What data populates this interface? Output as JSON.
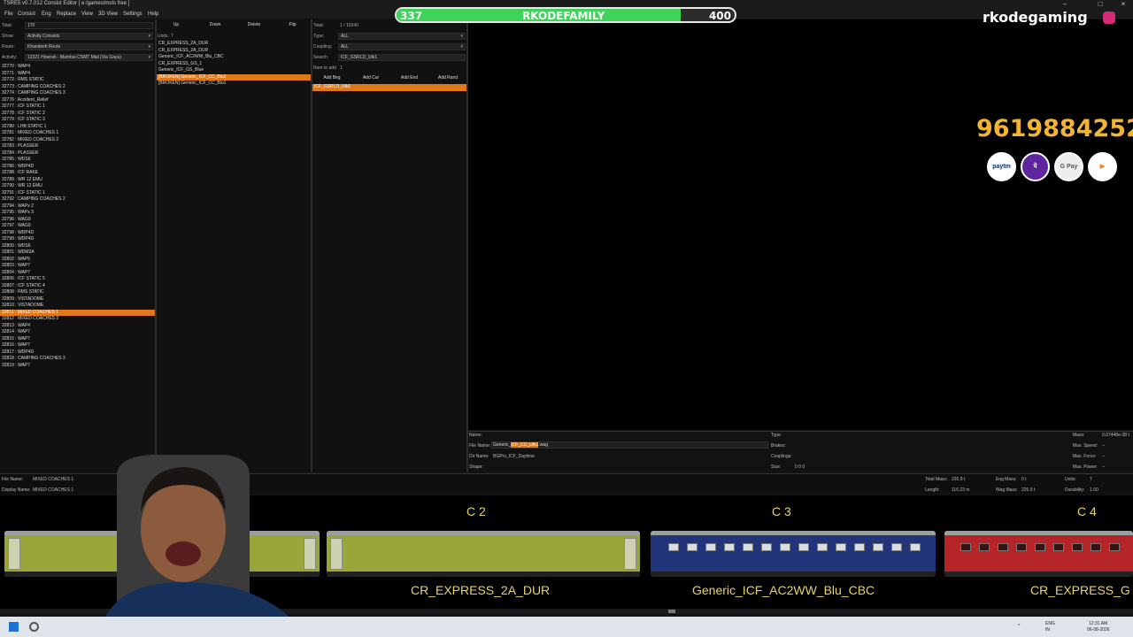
{
  "window": {
    "title": "TSRE5 v0.7.012 Consist Editor   [ e:/games/msts free ]"
  },
  "menu": [
    "File",
    "Consist",
    "Eng",
    "Replace",
    "View",
    "3D View",
    "Settings",
    "Help"
  ],
  "left_panel": {
    "total_label": "Total:",
    "total_value": "170",
    "show_label": "Show:",
    "show_value": "Activity Consists",
    "route_label": "Route:",
    "route_value": "Khandesh Route",
    "activity_label": "Activity:",
    "activity_value": "12321 Howrah - Mumbai CSMT Mail (Via Gaya)",
    "consists": [
      "32770 : WAP4",
      "32771 : WAP4",
      "32772 : RMS STATIC",
      "32773 : CAMPING COACHES 2",
      "32774 : CAMPING COACHES 3",
      "32776 : Accident_Relief",
      "32777 : ICF STATIC 1",
      "32778 : ICF STATIC 2",
      "32779 : ICF STATIC 3",
      "32780 : LHB STATIC 1",
      "32781 : MIXED COACHES 1",
      "32782 : MIXED COACHES 2",
      "32783 : PLASSER",
      "32784 : PLASSER",
      "32785 : WDS6",
      "32786 : WDP4D",
      "32788 : ICF RAKE",
      "32789 : WR 12 EMU",
      "32790 : WR 12 EMU",
      "32791 : ICF STATIC 1",
      "32792 : CAMPING COACHES 2",
      "32794 : WAPx 2",
      "32795 : WAPx 3",
      "32796 : WAG9",
      "32797 : WAG9",
      "32798 : WDP4D",
      "32799 : WDP4D",
      "32800 : WDS6",
      "32801 : WDM3A",
      "32802 : WAP5",
      "32803 : WAP7",
      "32804 : WAP7",
      "32806 : ICF STATIC 5",
      "32807 : ICF STATIC 4",
      "32808 : RMS STATIC",
      "32809 : VISTADOME",
      "32810 : VISTADOME",
      "32811 : MIXED COACHES 1",
      "32812 : MIXED COACHES 2",
      "32813 : WAP4",
      "32814 : WAP7",
      "32815 : WAP7",
      "32816 : WAP7",
      "32817 : WDP4D",
      "32818 : CAMPING COACHES 3",
      "32819 : WAP7"
    ],
    "selected_index": 37
  },
  "units_panel": {
    "up": "Up",
    "down": "Down",
    "delete": "Delete",
    "flip": "Flip",
    "units_label": "Units:",
    "units_value": "7",
    "units": [
      "CR_EXPRESS_2A_DUR",
      "CR_EXPRESS_2A_DUR",
      "Generic_ICF_AC2WW_Blu_CBC",
      "CR_EXPRESS_GS_1",
      "Generic_ICF_GS_Blue",
      "[BROKEN] Generic_ICF_CC_Blu1",
      "[BROKEN] Generic_ICF_CC_Blu1"
    ],
    "selected_index": 5
  },
  "search_panel": {
    "total_label": "Total:",
    "total_value": "1 / 10240",
    "type_label": "Type:",
    "type_value": "ALL",
    "coupling_label": "Coupling:",
    "coupling_value": "ALL",
    "search_label": "Search",
    "search_value": "ICF_GSRLD_Utk1",
    "num_label": "Num to add",
    "num_value": "1",
    "add_beg": "Add Beg",
    "add_cur": "Add Cur",
    "add_end": "Add End",
    "add_rand": "Add Rand",
    "results": [
      "ICF_GSRLD_Utk1"
    ]
  },
  "properties": {
    "name_label": "Name:",
    "filename_label": "File Name:",
    "filename_pre": "Generic_",
    "filename_hl": "ICF_CC_Utk1",
    "filename_post": ".wag",
    "dirname_label": "Dir Name:",
    "dirname_value": "BGPro_ICF_Daytime",
    "shape_label": "Shape:",
    "type_label": "Type:",
    "brakes_label": "Brakes:",
    "couplings_label": "Couplings:",
    "size_label": "Size:",
    "size_value": "0 0 0",
    "mass_label": "Mass:",
    "mass_value": "0.07448e-38 t",
    "maxspeed_label": "Max. Speed:",
    "maxspeed_value": "--",
    "maxforce_label": "Max. Force:",
    "maxforce_value": "--",
    "maxpower_label": "Max. Power:",
    "maxpower_value": "--"
  },
  "info": {
    "file_name_label": "File Name:",
    "file_name_value": "MIXED COACHES 1",
    "display_name_label": "Display Name:",
    "display_name_value": "MIXED COACHES 1",
    "total_mass_label": "Total Mass:",
    "total_mass_value": "226.9 t",
    "eng_mass_label": "Eng Mass:",
    "eng_mass_value": "0 t",
    "units_label": "Units:",
    "units_value": "7",
    "length_label": "Length:",
    "length_value": "116.23 m",
    "wag_mass_label": "Wag Mass:",
    "wag_mass_value": "226.9 t",
    "durability_label": "Durability:",
    "durability_value": "1.00"
  },
  "preview": {
    "labels": [
      "C 2",
      "C 3",
      "C 4"
    ],
    "names": [
      "CR_EXPRESS_2A_DUR",
      "Generic_ICF_AC2WW_Blu_CBC",
      "CR_EXPRESS_G"
    ]
  },
  "overlay": {
    "goal_left": "337",
    "goal_title": "RKODEFAMILY",
    "goal_right": "400",
    "goal_fill": 0.84,
    "brand": "rkodegaming",
    "phone": "9619884252",
    "pay_icons": [
      "paytm",
      "phonepe",
      "G Pay",
      "bhim"
    ]
  },
  "taskbar": {
    "lang": "ENG",
    "region": "IN",
    "time": "12:31 AM",
    "date": "06-08-2026"
  }
}
